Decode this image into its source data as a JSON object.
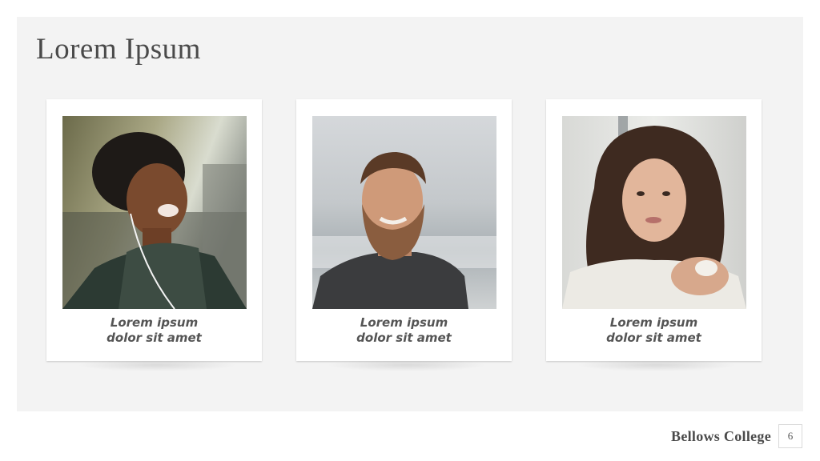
{
  "slide": {
    "title": "Lorem Ipsum",
    "footer_brand": "Bellows College",
    "page_number": "6"
  },
  "cards": [
    {
      "caption_line1": "Lorem ipsum",
      "caption_line2": "dolor sit amet",
      "photo_icon": "portrait-woman-curly-hair-photo"
    },
    {
      "caption_line1": "Lorem ipsum",
      "caption_line2": "dolor sit amet",
      "photo_icon": "portrait-bearded-man-photo"
    },
    {
      "caption_line1": "Lorem ipsum",
      "caption_line2": "dolor sit amet",
      "photo_icon": "portrait-woman-long-hair-photo"
    }
  ],
  "colors": {
    "panel_background": "#f3f3f3",
    "title_text": "#4a4a4a",
    "caption_text": "#555555"
  }
}
